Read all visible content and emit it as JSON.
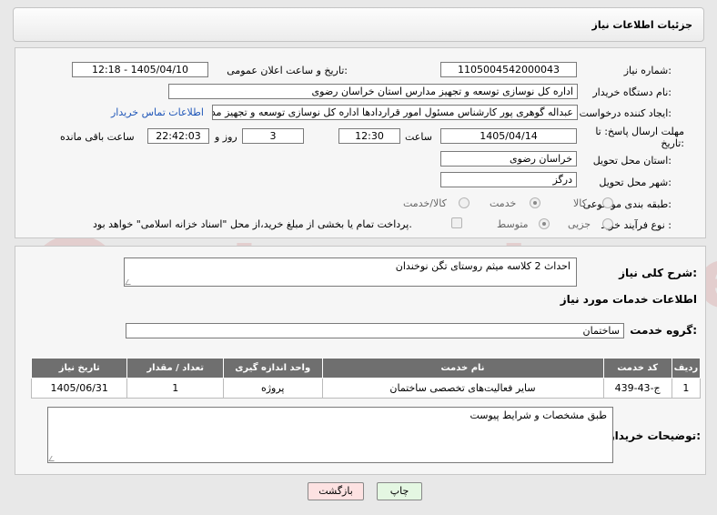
{
  "page_title": "جزئیات اطلاعات نیاز",
  "fields": {
    "need_number_label": "شماره نیاز:",
    "need_number": "1105004542000043",
    "announce_label": "تاریخ و ساعت اعلان عمومی:",
    "announce_value": "1405/04/10 - 12:18",
    "buyer_label": "نام دستگاه خریدار:",
    "buyer_value": "اداره کل نوسازی  توسعه و تجهیز مدارس استان خراسان رضوی",
    "creator_label": "ایجاد کننده درخواست:",
    "creator_value": "عبداله گوهری پور کارشناس مسئول امور قراردادها  اداره کل نوسازی  توسعه و تجهیز مدارس استان خراسان رضوی",
    "contact_link": "اطلاعات تماس خریدار",
    "deadline_label": "مهلت ارسال پاسخ: تا تاریخ:",
    "deadline_date": "1405/04/14",
    "time_label": "ساعت",
    "deadline_time": "12:30",
    "days_value": "3",
    "days_label": "روز و",
    "remaining_time": "22:42:03",
    "remaining_label": "ساعت باقی مانده",
    "province_label": "استان محل تحویل:",
    "province_value": "خراسان رضوی",
    "city_label": "شهر محل تحویل:",
    "city_value": "درگز",
    "category_label": "طبقه بندی موضوعی:",
    "category_options": [
      "کالا",
      "خدمت",
      "کالا/خدمت"
    ],
    "purchase_label": "نوع فرآیند خرید :",
    "purchase_options": [
      "جزیی",
      "متوسط"
    ],
    "payment_note": "پرداخت تمام یا بخشی از مبلغ خرید،از محل \"اسناد خزانه اسلامی\" خواهد بود."
  },
  "description": {
    "label": "شرح کلی نیاز:",
    "value": "احداث 2 کلاسه میثم روستای تگن نوخندان"
  },
  "services": {
    "section_title": "اطلاعات خدمات مورد نیاز",
    "group_label": "گروه خدمت:",
    "group_value": "ساختمان",
    "columns": [
      "ردیف",
      "کد خدمت",
      "نام خدمت",
      "واحد اندازه گیری",
      "تعداد / مقدار",
      "تاریخ نیاز"
    ],
    "rows": [
      [
        "1",
        "ج-43-439",
        "سایر فعالیت‌های تخصصی ساختمان",
        "پروژه",
        "1",
        "1405/06/31"
      ]
    ]
  },
  "buyer_notes": {
    "label": "توضیحات خریدار:",
    "value": "طبق مشخصات و شرایط پیوست"
  },
  "buttons": {
    "print": "چاپ",
    "back": "بازگشت"
  },
  "watermark": "AriaTender.net",
  "colors": {
    "link": "#1f56b8",
    "table_header": "#6f6f6f",
    "back_button": "#fde2e2",
    "print_button": "#e4f7e2"
  }
}
